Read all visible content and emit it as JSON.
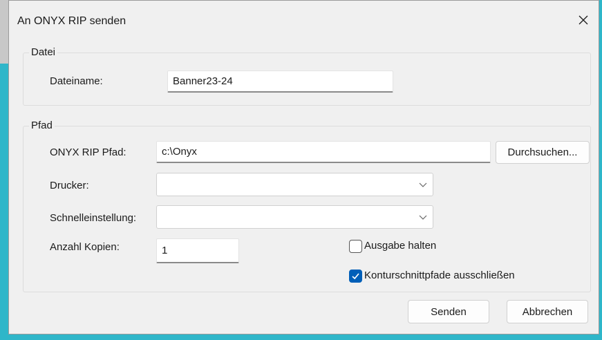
{
  "window": {
    "title": "An ONYX RIP senden"
  },
  "datei": {
    "legend": "Datei",
    "filename_label": "Dateiname:",
    "filename_value": "Banner23-24"
  },
  "pfad": {
    "legend": "Pfad",
    "rip_path_label": "ONYX RIP Pfad:",
    "rip_path_value": "c:\\Onyx",
    "browse_button": "Durchsuchen...",
    "printer_label": "Drucker:",
    "printer_value": "",
    "preset_label": "Schnelleinstellung:",
    "preset_value": "",
    "copies_label": "Anzahl Kopien:",
    "copies_value": "1",
    "hold_output_label": "Ausgabe halten",
    "hold_output_checked": false,
    "exclude_contour_label": "Konturschnittpfade ausschließen",
    "exclude_contour_checked": true
  },
  "buttons": {
    "send": "Senden",
    "cancel": "Abbrechen"
  },
  "colors": {
    "accent": "#005fb8",
    "background_accent": "#2fb6c9",
    "dialog_bg": "#f0f0f0"
  },
  "icons": {
    "close": "close-icon",
    "dropdown": "chevron-down-icon",
    "check": "checkmark-icon"
  }
}
